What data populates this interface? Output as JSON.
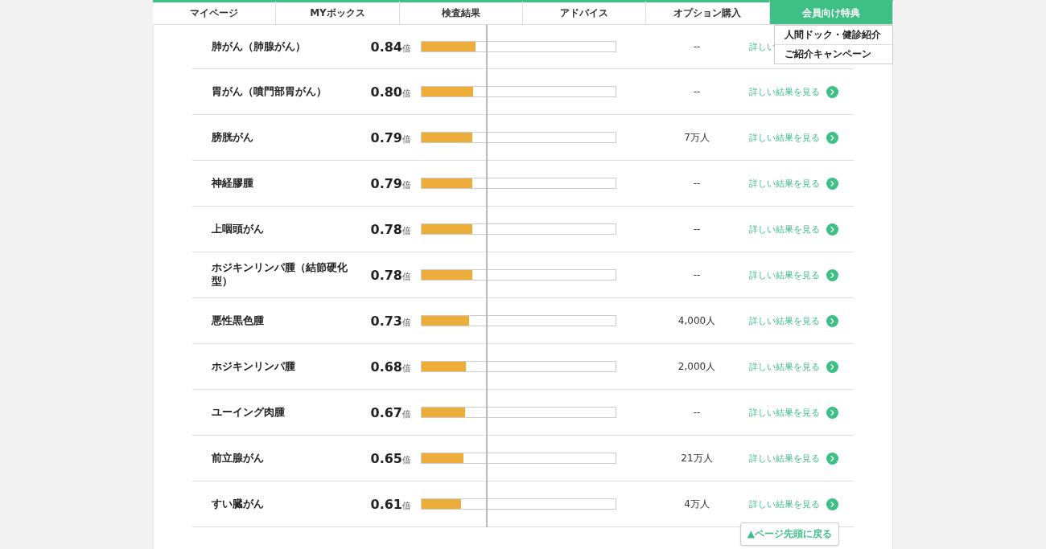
{
  "nav": {
    "tabs": [
      {
        "label": "マイページ",
        "selected": false
      },
      {
        "label": "MYボックス",
        "selected": false
      },
      {
        "label": "検査結果",
        "selected": false
      },
      {
        "label": "アドバイス",
        "selected": false
      },
      {
        "label": "オプション購入",
        "selected": false
      },
      {
        "label": "会員向け特典",
        "selected": true
      }
    ],
    "dropdown": [
      "人間ドック・健診紹介",
      "ご紹介キャンペーン"
    ]
  },
  "rows": [
    {
      "name": "肺がん（肺腺がん）",
      "value": "0.84",
      "unit": "倍",
      "level": 0.28,
      "count": "--",
      "link": "詳しい",
      "link_icon": false
    },
    {
      "name": "胃がん（噴門部胃がん）",
      "value": "0.80",
      "unit": "倍",
      "level": 0.267,
      "count": "--",
      "link": "詳しい結果を見る",
      "link_icon": true
    },
    {
      "name": "膀胱がん",
      "value": "0.79",
      "unit": "倍",
      "level": 0.263,
      "count": "7万人",
      "link": "詳しい結果を見る",
      "link_icon": true
    },
    {
      "name": "神経膠腫",
      "value": "0.79",
      "unit": "倍",
      "level": 0.263,
      "count": "--",
      "link": "詳しい結果を見る",
      "link_icon": true
    },
    {
      "name": "上咽頭がん",
      "value": "0.78",
      "unit": "倍",
      "level": 0.26,
      "count": "--",
      "link": "詳しい結果を見る",
      "link_icon": true
    },
    {
      "name": "ホジキンリンパ腫（結節硬化型）",
      "value": "0.78",
      "unit": "倍",
      "level": 0.26,
      "count": "--",
      "link": "詳しい結果を見る",
      "link_icon": true
    },
    {
      "name": "悪性黒色腫",
      "value": "0.73",
      "unit": "倍",
      "level": 0.243,
      "count": "4,000人",
      "link": "詳しい結果を見る",
      "link_icon": true
    },
    {
      "name": "ホジキンリンパ腫",
      "value": "0.68",
      "unit": "倍",
      "level": 0.227,
      "count": "2,000人",
      "link": "詳しい結果を見る",
      "link_icon": true
    },
    {
      "name": "ユーイング肉腫",
      "value": "0.67",
      "unit": "倍",
      "level": 0.223,
      "count": "--",
      "link": "詳しい結果を見る",
      "link_icon": true
    },
    {
      "name": "前立腺がん",
      "value": "0.65",
      "unit": "倍",
      "level": 0.217,
      "count": "21万人",
      "link": "詳しい結果を見る",
      "link_icon": true
    },
    {
      "name": "すい臓がん",
      "value": "0.61",
      "unit": "倍",
      "level": 0.203,
      "count": "4万人",
      "link": "詳しい結果を見る",
      "link_icon": true
    }
  ],
  "back_to_top": "▲ページ先頭に戻る"
}
